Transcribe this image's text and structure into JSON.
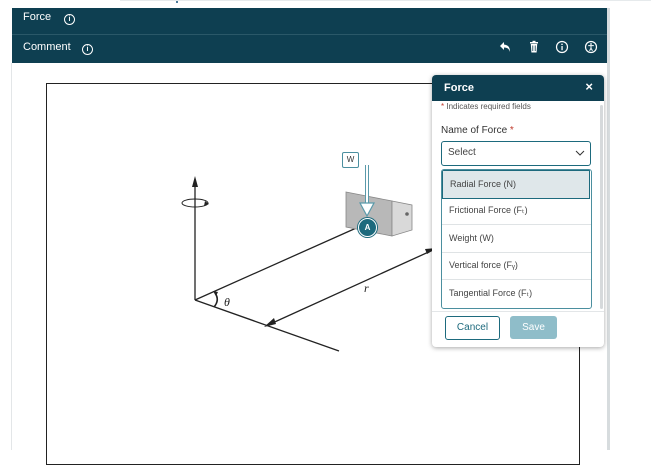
{
  "toolbar": {
    "row1_label": "Force",
    "row2_label": "Comment",
    "info_glyph": "i",
    "actions": [
      {
        "name": "undo-icon",
        "glyph": "↶"
      },
      {
        "name": "trash-icon",
        "glyph": "🗑"
      },
      {
        "name": "info-icon",
        "glyph": "ⓘ"
      },
      {
        "name": "accessibility-icon",
        "glyph": "♿"
      }
    ]
  },
  "diagram": {
    "theta_label": "θ",
    "r_label": "r",
    "w_marker": "W",
    "a_marker": "A"
  },
  "panel": {
    "title": "Force",
    "close_glyph": "×",
    "required_star": "*",
    "required_note": " Indicates required fields",
    "field_label": "Name of Force ",
    "field_star": "*",
    "select_value": "Select",
    "select_chevron": "⌵",
    "options": [
      "Radial Force (N)",
      "Frictional Force (Fₜ)",
      "Weight (W)",
      "Vertical force (Fᵧ)",
      "Tangential Force (Fₜ)"
    ],
    "cancel_label": "Cancel",
    "save_label": "Save"
  },
  "colors": {
    "toolbar_bg": "#0e3f51",
    "accent": "#1d6a7d",
    "save_disabled": "#8fbdc9"
  }
}
